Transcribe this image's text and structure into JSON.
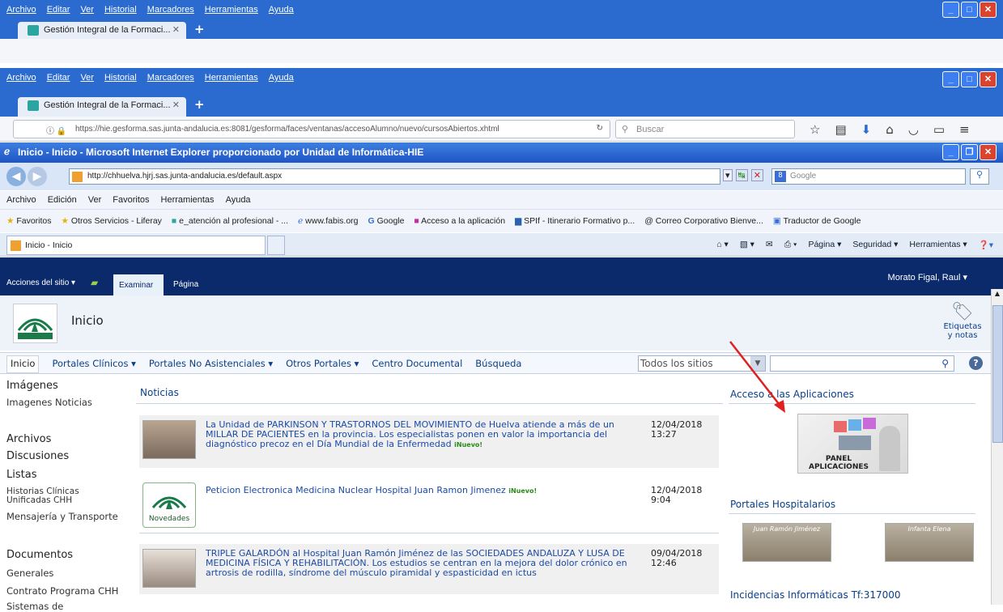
{
  "firefox1": {
    "menu": [
      "Archivo",
      "Editar",
      "Ver",
      "Historial",
      "Marcadores",
      "Herramientas",
      "Ayuda"
    ],
    "tab": "Gestión Integral de la Formaci..."
  },
  "firefox2": {
    "menu": [
      "Archivo",
      "Editar",
      "Ver",
      "Historial",
      "Marcadores",
      "Herramientas",
      "Ayuda"
    ],
    "tab": "Gestión Integral de la Formaci...",
    "url": "https://hie.gesforma.sas.junta-andalucia.es:8081/gesforma/faces/ventanas/accesoAlumno/nuevo/cursosAbiertos.xhtml",
    "search_placeholder": "Buscar"
  },
  "ie": {
    "title": "Inicio - Inicio - Microsoft Internet Explorer proporcionado por Unidad de Informática-HIE",
    "url": "http://chhuelva.hjrj.sas.junta-andalucia.es/default.aspx",
    "search_placeholder": "Google",
    "menu": [
      "Archivo",
      "Edición",
      "Ver",
      "Favoritos",
      "Herramientas",
      "Ayuda"
    ],
    "favorites": [
      "Favoritos",
      "Otros Servicios - Liferay",
      "e_atención al profesional - ...",
      "www.fabis.org",
      "Google",
      "Acceso a la aplicación",
      "SPIf - Itinerario Formativo p...",
      "Correo Corporativo Bienve...",
      "Traductor de Google"
    ],
    "tab": "Inicio - Inicio",
    "cmd": [
      "Página ▾",
      "Seguridad ▾",
      "Herramientas ▾"
    ]
  },
  "sp": {
    "site_actions": "Acciones del sitio ▾",
    "tab_examinar": "Examinar",
    "tab_pagina": "Página",
    "user": "Morato Figal, Raul ▾",
    "title": "Inicio",
    "tags_label": "Etiquetas y notas",
    "nav": [
      "Inicio",
      "Portales Clínicos ▾",
      "Portales No Asistenciales ▾",
      "Otros Portales ▾",
      "Centro Documental",
      "Búsqueda"
    ],
    "site_scope": "Todos los sitios",
    "left": [
      "Imágenes",
      "Imagenes Noticias",
      "Archivos",
      "Discusiones",
      "Listas",
      "Historias Clínicas Unificadas CHH",
      "Mensajería y Transporte",
      "Documentos",
      "Generales",
      "Contrato Programa CHH",
      "Sistemas de"
    ],
    "noticias_title": "Noticias",
    "news": [
      {
        "text": "La Unidad de PARKINSON Y TRASTORNOS DEL MOVIMIENTO de Huelva atiende a más de un MILLAR DE PACIENTES en la provincia. Los especialistas ponen en valor la importancia del diagnóstico precoz en el Día Mundial de la Enfermedad",
        "date": "12/04/2018",
        "time": "13:27",
        "badge": "Nuevo"
      },
      {
        "text": "Peticion Electronica Medicina Nuclear Hospital Juan Ramon Jimenez",
        "date": "12/04/2018",
        "time": "9:04",
        "badge": "Nuevo",
        "thumb": "Novedades"
      },
      {
        "text": "TRIPLE GALARDÓN al Hospital Juan Ramón Jiménez de las SOCIEDADES ANDALUZA Y LUSA DE MEDICINA FÍSICA Y REHABILITACIÓN. Los estudios se centran en la mejora del dolor crónico en artrosis de rodilla, síndrome del músculo piramidal y espasticidad en ictus",
        "date": "09/04/2018",
        "time": "12:46"
      }
    ],
    "right_apps": "Acceso a las Aplicaciones",
    "panel_label": "PANEL APLICACIONES",
    "right_hosp": "Portales Hospitalarios",
    "hosp1": "Juan Ramón Jiménez",
    "hosp2": "Infanta Elena",
    "right_inc": "Incidencias Informáticas Tf:317000"
  }
}
